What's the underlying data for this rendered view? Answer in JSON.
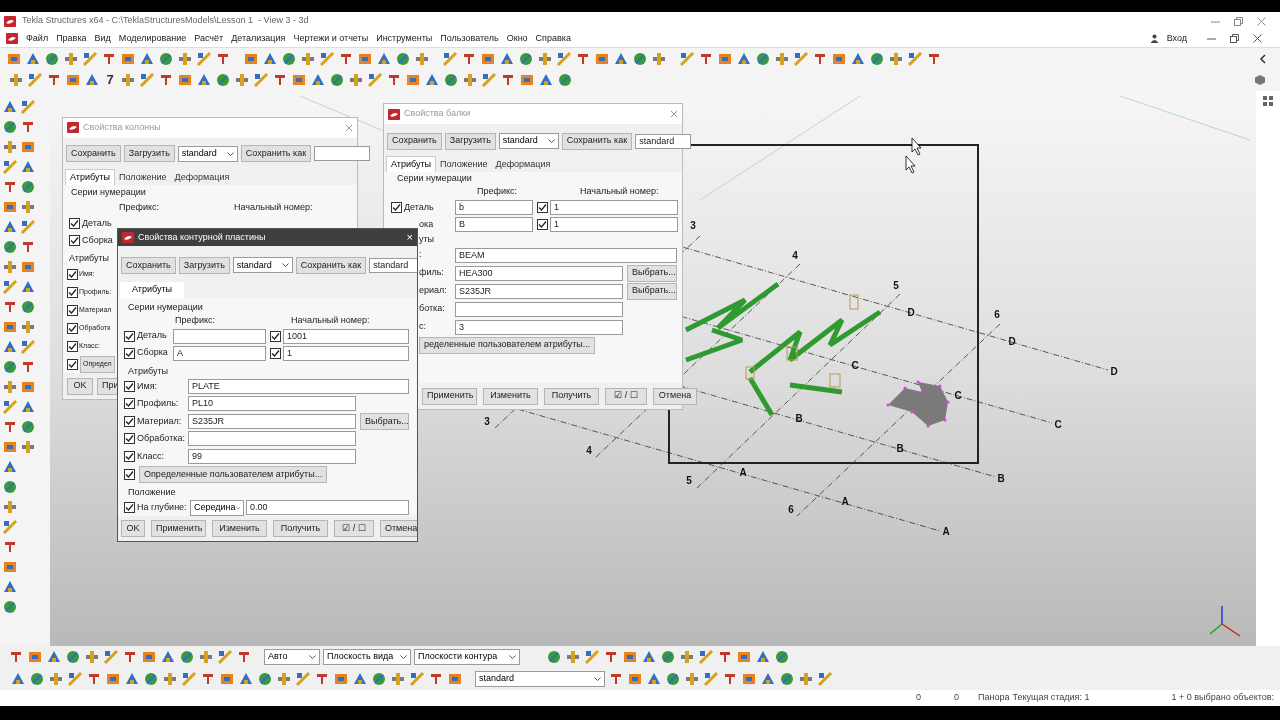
{
  "title_bar": {
    "title": "Tekla Structures x64 - C:\\TeklaStructuresModels\\Lesson 1  - View 3 - 3d"
  },
  "menu": {
    "items": [
      "Файл",
      "Правка",
      "Вид",
      "Моделирование",
      "Расчёт",
      "Детализация",
      "Чертежи и отчеты",
      "Инструменты",
      "Пользователь",
      "Окно",
      "Справка"
    ],
    "login": "Вход"
  },
  "toolbar": {
    "label": "7"
  },
  "viewport": {
    "grid_labels": [
      "3",
      "4",
      "5",
      "6",
      "D",
      "D",
      "D",
      "C",
      "C",
      "C",
      "B",
      "B",
      "B",
      "A",
      "A",
      "A",
      "3",
      "4",
      "5",
      "6"
    ]
  },
  "column_dialog": {
    "title": "Свойства колонны",
    "save": "Сохранить",
    "load": "Загрузить",
    "preset": "standard",
    "save_as": "Сохранить как",
    "tabs": [
      {
        "label": "Атрибуты",
        "selected": true
      },
      {
        "label": "Положение",
        "selected": false
      },
      {
        "label": "Деформация",
        "selected": false
      }
    ],
    "numbering": "Серии нумерации",
    "prefix": "Префикс:",
    "start": "Начальный номер:",
    "rows": [
      {
        "label": "Деталь",
        "checked": true
      },
      {
        "label": "Сборка",
        "checked": true
      }
    ],
    "attributes": "Атрибуты",
    "attr_rows": [
      {
        "label": "Имя:",
        "checked": true
      },
      {
        "label": "Профиль:",
        "checked": true
      },
      {
        "label": "Материал",
        "checked": true
      },
      {
        "label": "Обработк",
        "checked": true
      },
      {
        "label": "Класс:",
        "checked": true
      }
    ],
    "udf": {
      "label": "Определ",
      "checked": true
    },
    "ok": "OK",
    "apply": "При"
  },
  "beam_dialog": {
    "title": "Свойства балки",
    "save": "Сохранить",
    "load": "Загрузить",
    "preset": "standard",
    "save_as": "Сохранить как",
    "save_as_value": "standard",
    "tabs": [
      {
        "label": "Атрибуты",
        "selected": true
      },
      {
        "label": "Положение",
        "selected": false
      },
      {
        "label": "Деформация",
        "selected": false
      }
    ],
    "numbering": "Серии нумерации",
    "prefix": "Префикс:",
    "start": "Начальный номер:",
    "part": {
      "label": "Деталь",
      "checked": true,
      "prefix": "b",
      "start_checked": true,
      "start": "1"
    },
    "assembly": {
      "label": "ока",
      "prefix": "B",
      "start_checked": true,
      "start": "1"
    },
    "attributes": "уты",
    "attr_rows": [
      {
        "label": ":",
        "value": "BEAM",
        "kind": "wide"
      },
      {
        "label": "филь:",
        "value": "HEA300",
        "kind": "pick",
        "pick": "Выбрать..."
      },
      {
        "label": "ериал:",
        "value": "S235JR",
        "kind": "pick",
        "pick": "Выбрать..."
      },
      {
        "label": "ботка:",
        "kind": "field"
      },
      {
        "label": "с:",
        "value": "3",
        "kind": "field"
      }
    ],
    "udf": "ределенные пользователем атрибуты...",
    "buttons": [
      "Применить",
      "Изменить",
      "Получить"
    ],
    "toggle": "☑ / ☐",
    "cancel": "Отмена"
  },
  "plate_dialog": {
    "title": "Свойства контурной пластины",
    "close": "×",
    "save": "Сохранить",
    "load": "Загрузить",
    "preset": "standard",
    "save_as": "Сохранить как",
    "save_as_value": "standard",
    "tabs": [
      {
        "label": "Атрибуты",
        "selected": true
      }
    ],
    "numbering": "Серии нумерации",
    "prefix": "Префикс:",
    "start": "Начальный номер:",
    "rows": [
      {
        "label": "Деталь",
        "checked": true,
        "start_checked": true,
        "start": "1001"
      },
      {
        "label": "Сборка",
        "checked": true,
        "prefix": "A",
        "start_checked": true,
        "start": "1"
      }
    ],
    "attributes": "Атрибуты",
    "attr_rows": [
      {
        "label": "Имя:",
        "checked": true,
        "value": "PLATE",
        "kind": "wide"
      },
      {
        "label": "Профиль:",
        "checked": true,
        "value": "PL10",
        "kind": "field"
      },
      {
        "label": "Материал:",
        "checked": true,
        "value": "S235JR",
        "kind": "pick",
        "pick": "Выбрать..."
      },
      {
        "label": "Обработка:",
        "checked": true,
        "kind": "field"
      },
      {
        "label": "Класс:",
        "checked": true,
        "value": "99",
        "kind": "field"
      }
    ],
    "udf": {
      "label": "Определенные пользователем атрибуты...",
      "checked": true
    },
    "position": "Положение",
    "depth": {
      "label": "На глубине:",
      "checked": true,
      "option": "Середина",
      "value": "0.00"
    },
    "buttons": [
      "OK",
      "Применить",
      "Изменить",
      "Получить"
    ],
    "toggle": "☑ / ☐",
    "cancel": "Отмена"
  },
  "bottom_toolbar": {
    "selects": [
      "Авто",
      "Плоскость вида",
      "Плоскости контура"
    ],
    "filter": "standard"
  },
  "status_bar": {
    "fields": [
      "0",
      "0",
      "Панора",
      "Текущая стадия: 1"
    ],
    "selection": "1 + 0 выбрано объектов:"
  }
}
